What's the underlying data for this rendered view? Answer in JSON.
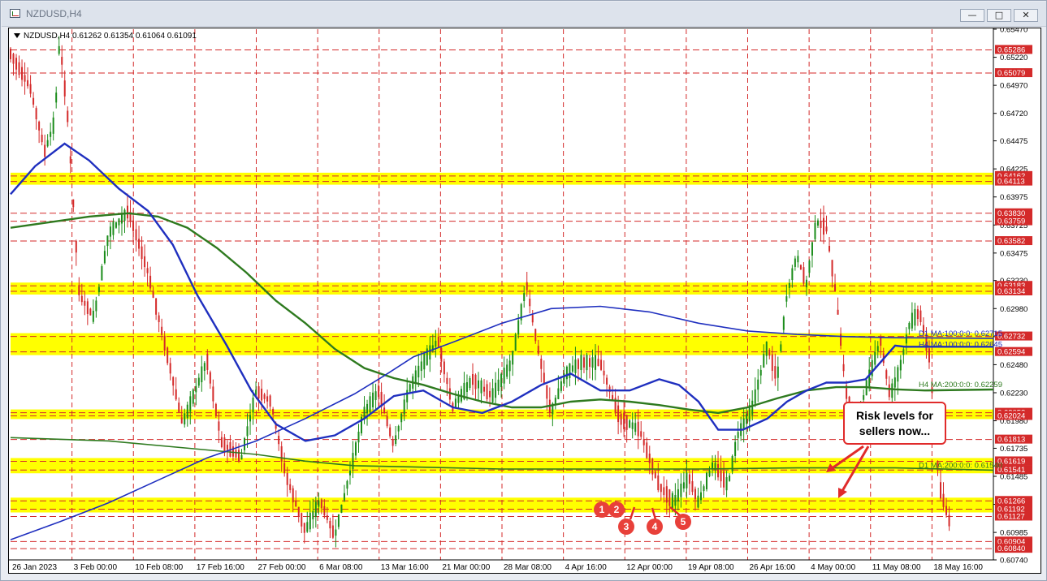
{
  "window": {
    "title": "NZDUSD,H4",
    "buttons": {
      "minimize": "—",
      "maximize": "□",
      "close": "✕"
    }
  },
  "chart": {
    "symbol_info": "NZDUSD,H4  0.61262 0.61354 0.61064 0.61091",
    "annotation": {
      "line1": "Risk levels for",
      "line2": "sellers now..."
    },
    "markers": [
      "1",
      "2",
      "3",
      "4",
      "5"
    ],
    "colors": {
      "bull": "#1a8c1a",
      "bear": "#d42a2a",
      "ma100": "#1f2fbf",
      "ma200": "#2e7a1f",
      "zone": "#ffff00",
      "hline": "#d42a2a"
    }
  },
  "chart_data": {
    "type": "candlestick",
    "instrument": "NZDUSD",
    "timeframe": "H4",
    "ohlc_last": {
      "open": 0.61262,
      "high": 0.61354,
      "low": 0.61064,
      "close": 0.61091
    },
    "ylim": [
      0.6074,
      0.6547
    ],
    "y_ticks": [
      "0.65470",
      "0.65220",
      "0.64970",
      "0.64720",
      "0.64475",
      "0.64225",
      "0.63975",
      "0.63725",
      "0.63475",
      "0.63230",
      "0.62980",
      "0.62730",
      "0.62480",
      "0.62230",
      "0.61980",
      "0.61735",
      "0.61485",
      "0.61235",
      "0.60985",
      "0.60740"
    ],
    "x_ticks": [
      "26 Jan 2023",
      "3 Feb 00:00",
      "10 Feb 08:00",
      "17 Feb 16:00",
      "27 Feb 00:00",
      "6 Mar 08:00",
      "13 Mar 16:00",
      "21 Mar 00:00",
      "28 Mar 08:00",
      "4 Apr 16:00",
      "12 Apr 00:00",
      "19 Apr 08:00",
      "26 Apr 16:00",
      "4 May 00:00",
      "11 May 08:00",
      "18 May 16:00"
    ],
    "levels": [
      "0.65286",
      "0.65079",
      "0.64162",
      "0.64113",
      "0.63830",
      "0.63759",
      "0.63582",
      "0.63183",
      "0.63134",
      "0.62732",
      "0.62594",
      "0.62052",
      "0.62024",
      "0.61813",
      "0.61619",
      "0.61541",
      "0.61266",
      "0.61192",
      "0.61127",
      "0.60904",
      "0.60840"
    ],
    "zones": [
      [
        0.64113,
        0.64162
      ],
      [
        0.62594,
        0.62732
      ],
      [
        0.63134,
        0.63183
      ],
      [
        0.62024,
        0.62052
      ],
      [
        0.61541,
        0.61619
      ],
      [
        0.61192,
        0.61266
      ]
    ],
    "indicators": [
      {
        "label": "D1 MA:100:0:0: 0.62715",
        "value": 0.62715
      },
      {
        "label": "H4 MA:100:0:0: 0.62645",
        "value": 0.62645
      },
      {
        "label": "H4 MA:200:0:0: 0.62259",
        "value": 0.62259
      },
      {
        "label": "D1 MA:200:0:0: 0.61540",
        "value": 0.6154
      }
    ],
    "price_path": [
      [
        0,
        0.6525
      ],
      [
        0.02,
        0.6495
      ],
      [
        0.035,
        0.6438
      ],
      [
        0.045,
        0.6465
      ],
      [
        0.05,
        0.6538
      ],
      [
        0.058,
        0.647
      ],
      [
        0.07,
        0.631
      ],
      [
        0.085,
        0.629
      ],
      [
        0.1,
        0.6365
      ],
      [
        0.12,
        0.6385
      ],
      [
        0.14,
        0.633
      ],
      [
        0.16,
        0.6255
      ],
      [
        0.175,
        0.6195
      ],
      [
        0.2,
        0.6252
      ],
      [
        0.215,
        0.6178
      ],
      [
        0.235,
        0.6165
      ],
      [
        0.25,
        0.6225
      ],
      [
        0.265,
        0.6215
      ],
      [
        0.28,
        0.615
      ],
      [
        0.3,
        0.61
      ],
      [
        0.315,
        0.6127
      ],
      [
        0.33,
        0.6095
      ],
      [
        0.345,
        0.615
      ],
      [
        0.36,
        0.6205
      ],
      [
        0.375,
        0.6225
      ],
      [
        0.39,
        0.6175
      ],
      [
        0.405,
        0.6225
      ],
      [
        0.42,
        0.625
      ],
      [
        0.435,
        0.627
      ],
      [
        0.45,
        0.621
      ],
      [
        0.47,
        0.6235
      ],
      [
        0.49,
        0.622
      ],
      [
        0.51,
        0.625
      ],
      [
        0.525,
        0.632
      ],
      [
        0.535,
        0.627
      ],
      [
        0.55,
        0.6205
      ],
      [
        0.565,
        0.624
      ],
      [
        0.58,
        0.625
      ],
      [
        0.6,
        0.625
      ],
      [
        0.62,
        0.62
      ],
      [
        0.64,
        0.619
      ],
      [
        0.66,
        0.614
      ],
      [
        0.675,
        0.6125
      ],
      [
        0.69,
        0.6148
      ],
      [
        0.7,
        0.6125
      ],
      [
        0.715,
        0.616
      ],
      [
        0.73,
        0.614
      ],
      [
        0.74,
        0.6185
      ],
      [
        0.755,
        0.621
      ],
      [
        0.77,
        0.6265
      ],
      [
        0.78,
        0.6235
      ],
      [
        0.79,
        0.631
      ],
      [
        0.8,
        0.6345
      ],
      [
        0.81,
        0.632
      ],
      [
        0.82,
        0.6375
      ],
      [
        0.83,
        0.637
      ],
      [
        0.84,
        0.631
      ],
      [
        0.85,
        0.6225
      ],
      [
        0.86,
        0.6195
      ],
      [
        0.875,
        0.624
      ],
      [
        0.885,
        0.627
      ],
      [
        0.895,
        0.622
      ],
      [
        0.905,
        0.6245
      ],
      [
        0.915,
        0.6285
      ],
      [
        0.925,
        0.6295
      ],
      [
        0.935,
        0.6255
      ],
      [
        0.945,
        0.614
      ],
      [
        0.955,
        0.6109
      ]
    ],
    "ma_h4_100": [
      [
        0,
        0.64
      ],
      [
        0.025,
        0.6425
      ],
      [
        0.055,
        0.6445
      ],
      [
        0.08,
        0.643
      ],
      [
        0.11,
        0.6405
      ],
      [
        0.14,
        0.6385
      ],
      [
        0.165,
        0.6355
      ],
      [
        0.19,
        0.631
      ],
      [
        0.22,
        0.6265
      ],
      [
        0.245,
        0.6225
      ],
      [
        0.27,
        0.6195
      ],
      [
        0.3,
        0.618
      ],
      [
        0.33,
        0.6185
      ],
      [
        0.36,
        0.62
      ],
      [
        0.39,
        0.622
      ],
      [
        0.42,
        0.6225
      ],
      [
        0.45,
        0.621
      ],
      [
        0.48,
        0.6205
      ],
      [
        0.51,
        0.6215
      ],
      [
        0.54,
        0.623
      ],
      [
        0.57,
        0.624
      ],
      [
        0.6,
        0.6225
      ],
      [
        0.63,
        0.6225
      ],
      [
        0.66,
        0.6235
      ],
      [
        0.68,
        0.623
      ],
      [
        0.7,
        0.6215
      ],
      [
        0.72,
        0.619
      ],
      [
        0.745,
        0.619
      ],
      [
        0.77,
        0.62
      ],
      [
        0.79,
        0.6215
      ],
      [
        0.81,
        0.6225
      ],
      [
        0.83,
        0.6232
      ],
      [
        0.85,
        0.6232
      ],
      [
        0.87,
        0.6235
      ],
      [
        0.88,
        0.6245
      ],
      [
        0.89,
        0.6255
      ],
      [
        0.9,
        0.6265
      ],
      [
        0.91,
        0.6264
      ],
      [
        0.95,
        0.6264
      ],
      [
        1.0,
        0.6264
      ]
    ],
    "ma_d1_100": [
      [
        0,
        0.6092
      ],
      [
        0.05,
        0.6108
      ],
      [
        0.1,
        0.6125
      ],
      [
        0.15,
        0.6145
      ],
      [
        0.2,
        0.6165
      ],
      [
        0.25,
        0.618
      ],
      [
        0.3,
        0.62
      ],
      [
        0.35,
        0.6222
      ],
      [
        0.38,
        0.6238
      ],
      [
        0.41,
        0.6255
      ],
      [
        0.45,
        0.6268
      ],
      [
        0.5,
        0.6285
      ],
      [
        0.55,
        0.6298
      ],
      [
        0.6,
        0.63
      ],
      [
        0.65,
        0.6295
      ],
      [
        0.7,
        0.6285
      ],
      [
        0.75,
        0.6278
      ],
      [
        0.8,
        0.6275
      ],
      [
        0.85,
        0.6273
      ],
      [
        0.9,
        0.6272
      ],
      [
        1.0,
        0.62715
      ]
    ],
    "ma_h4_200": [
      [
        0,
        0.637
      ],
      [
        0.04,
        0.6375
      ],
      [
        0.08,
        0.638
      ],
      [
        0.12,
        0.6383
      ],
      [
        0.15,
        0.638
      ],
      [
        0.18,
        0.637
      ],
      [
        0.21,
        0.6352
      ],
      [
        0.24,
        0.633
      ],
      [
        0.27,
        0.6305
      ],
      [
        0.3,
        0.6285
      ],
      [
        0.33,
        0.6262
      ],
      [
        0.36,
        0.6245
      ],
      [
        0.39,
        0.6236
      ],
      [
        0.42,
        0.623
      ],
      [
        0.45,
        0.6222
      ],
      [
        0.48,
        0.6215
      ],
      [
        0.51,
        0.621
      ],
      [
        0.54,
        0.621
      ],
      [
        0.57,
        0.6215
      ],
      [
        0.6,
        0.6217
      ],
      [
        0.63,
        0.6215
      ],
      [
        0.66,
        0.6212
      ],
      [
        0.69,
        0.6208
      ],
      [
        0.72,
        0.6205
      ],
      [
        0.75,
        0.621
      ],
      [
        0.78,
        0.6218
      ],
      [
        0.81,
        0.6225
      ],
      [
        0.84,
        0.6228
      ],
      [
        0.87,
        0.6228
      ],
      [
        0.9,
        0.6226
      ],
      [
        0.93,
        0.6225
      ],
      [
        1.0,
        0.62259
      ]
    ],
    "ma_d1_200": [
      [
        0,
        0.6183
      ],
      [
        0.1,
        0.618
      ],
      [
        0.2,
        0.6172
      ],
      [
        0.25,
        0.6168
      ],
      [
        0.3,
        0.6162
      ],
      [
        0.35,
        0.6158
      ],
      [
        0.4,
        0.6157
      ],
      [
        0.5,
        0.6155
      ],
      [
        0.6,
        0.6155
      ],
      [
        0.7,
        0.6155
      ],
      [
        0.8,
        0.6156
      ],
      [
        0.9,
        0.6156
      ],
      [
        1.0,
        0.6154
      ]
    ]
  }
}
